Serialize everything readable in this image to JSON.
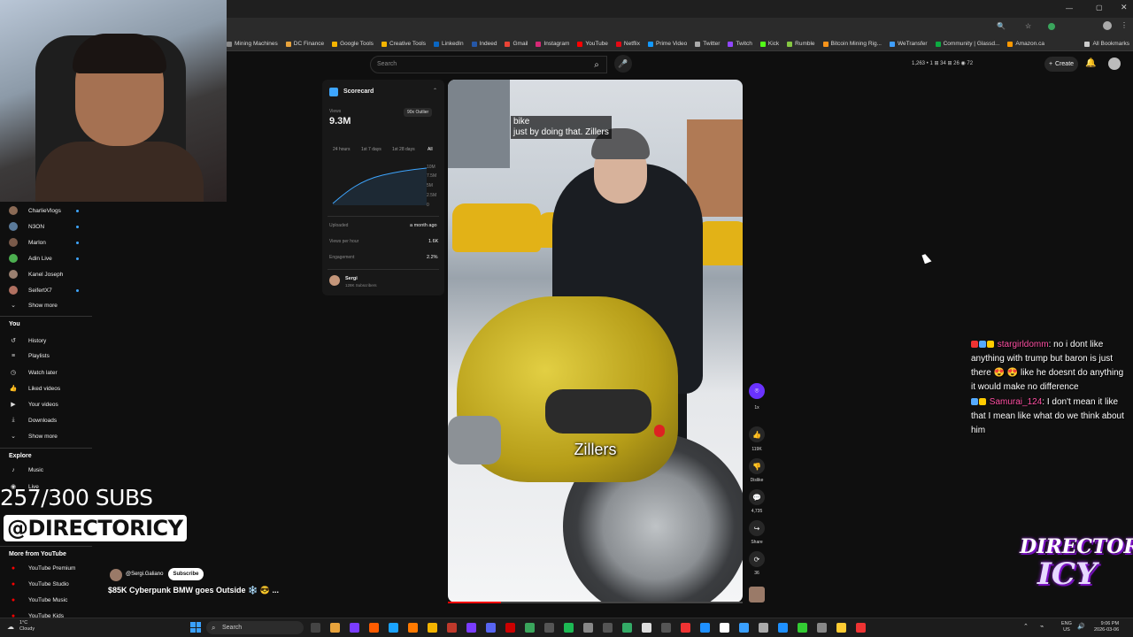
{
  "bookmarks": [
    "Mining Machines",
    "DC Finance",
    "Google Tools",
    "Creative Tools",
    "LinkedIn",
    "Indeed",
    "Gmail",
    "Instagram",
    "YouTube",
    "Netflix",
    "Prime Video",
    "Twitter",
    "Twitch",
    "Kick",
    "Rumble",
    "Bitcoin Mining Rig...",
    "WeTransfer",
    "Community | Glassd...",
    "Amazon.ca",
    "All Bookmarks"
  ],
  "header": {
    "search_placeholder": "Search",
    "stats": "1,263 • 1 ⊞ 34 ⊞ 26 ◉ 72",
    "create_label": "Create"
  },
  "sidebar": {
    "subscriptions": [
      {
        "label": "CharlieVlogs",
        "color": "#8a6a55"
      },
      {
        "label": "N3ON",
        "color": "#5a7a9a"
      },
      {
        "label": "Marlon",
        "color": "#7a5a4a"
      },
      {
        "label": "Adin Live",
        "color": "#4caf50"
      },
      {
        "label": "Kanel Joseph",
        "color": "#9a8070"
      },
      {
        "label": "SeifertX7",
        "color": "#b07060"
      }
    ],
    "show_more": "Show more",
    "you_heading": "You",
    "you_items": [
      {
        "label": "History",
        "icon": "history-icon"
      },
      {
        "label": "Playlists",
        "icon": "playlists-icon"
      },
      {
        "label": "Watch later",
        "icon": "watch-later-icon"
      },
      {
        "label": "Liked videos",
        "icon": "liked-videos-icon"
      },
      {
        "label": "Your videos",
        "icon": "your-videos-icon"
      },
      {
        "label": "Downloads",
        "icon": "downloads-icon"
      }
    ],
    "show_more_2": "Show more",
    "explore_heading": "Explore",
    "explore_items": [
      "Music",
      "Live"
    ],
    "more_heading": "More from YouTube",
    "more_items": [
      "YouTube Premium",
      "YouTube Studio",
      "YouTube Music",
      "YouTube Kids"
    ]
  },
  "overlay": {
    "subs_goal": "257/300 SUBS",
    "handle": "@DIRECTORICY"
  },
  "scorecard": {
    "title": "Scorecard",
    "views_label": "Views",
    "views_value": "9.3M",
    "outlier_badge": "90x Outlier",
    "tabs": [
      "24 hours",
      "1st 7 days",
      "1st 28 days",
      "All"
    ],
    "y_ticks": [
      "10M",
      "7.5M",
      "5M",
      "2.5M",
      "0"
    ],
    "uploaded_label": "Uploaded",
    "uploaded_value": "a month ago",
    "vph_label": "Views per hour",
    "vph_value": "1.6K",
    "engagement_label": "Engagement",
    "engagement_value": "2.2%",
    "channel_name": "Sergi",
    "channel_subs": "128K Subscribers"
  },
  "video": {
    "caption_line1": "bike",
    "caption_line2": "just by doing that. Zillers",
    "caption_big": "Zillers",
    "progress_fraction": 0.18
  },
  "rail": {
    "speed": "1x",
    "like_count": "119K",
    "dislike_label": "Dislike",
    "comments_count": "4,735",
    "share_label": "Share",
    "remix_count": "36"
  },
  "meta": {
    "channel": "@Sergi.Galiano",
    "subscribe_label": "Subscribe",
    "title": "$85K Cyberpunk BMW goes Outside ❄️ 😎 ..."
  },
  "chat": [
    {
      "user": "stargirldomm",
      "text": ": no i dont like anything with trump but baron is just there 😍 😍 like he doesnt do anything it would make no difference"
    },
    {
      "user": "Samurai_124",
      "text": ": I don't mean it like that I mean like what do we think about him"
    }
  ],
  "logo": {
    "line1": "DIRECTOR",
    "line2": "ICY"
  },
  "taskbar": {
    "temp": "1°C",
    "weather": "Cloudy",
    "search_label": "Search",
    "lang1": "ENG",
    "lang2": "US",
    "time": "9:06 PM",
    "date": "2026-03-06"
  }
}
